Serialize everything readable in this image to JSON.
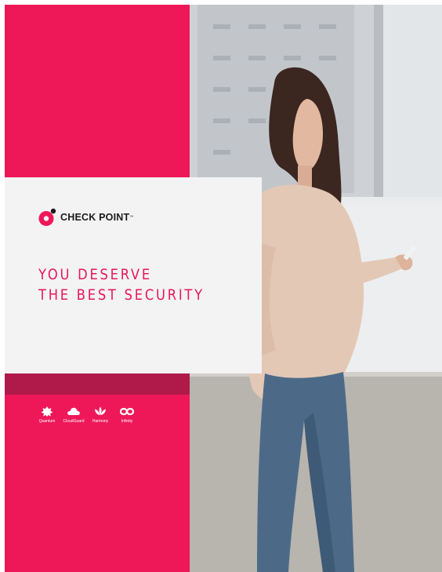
{
  "brand": {
    "name": "CHECK POINT",
    "trademark": "™",
    "logo_icon": "check-point-logo-icon"
  },
  "headline": {
    "line1": "YOU DESERVE",
    "line2": "THE BEST SECURITY"
  },
  "products": [
    {
      "label": "Quantum",
      "icon": "quantum-icon"
    },
    {
      "label": "CloudGuard",
      "icon": "cloud-icon"
    },
    {
      "label": "Harmony",
      "icon": "lotus-icon"
    },
    {
      "label": "Infinity",
      "icon": "infinity-icon"
    }
  ],
  "colors": {
    "brand_pink": "#ee1859",
    "dark_band": "#b01a4a",
    "headline": "#e8175b",
    "card": "#f3f3f4"
  },
  "photo": {
    "subject": "photo-woman-with-phone"
  }
}
